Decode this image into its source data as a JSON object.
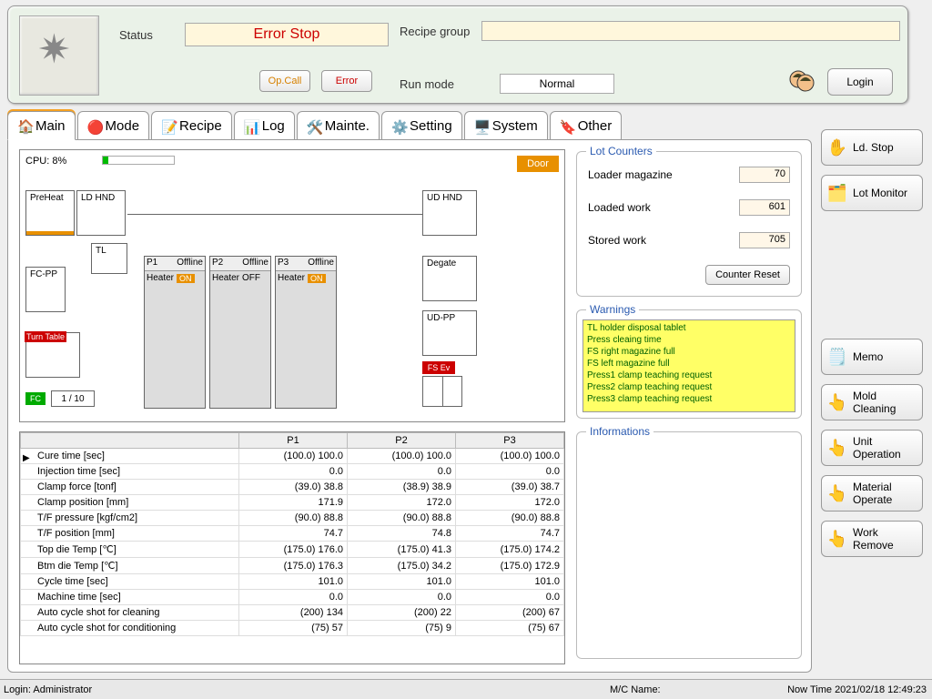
{
  "header": {
    "status_label": "Status",
    "status_value": "Error Stop",
    "opcall": "Op.Call",
    "error": "Error",
    "recipe_group_label": "Recipe group",
    "recipe_group_value": "",
    "run_mode_label": "Run mode",
    "run_mode_value": "Normal",
    "login": "Login"
  },
  "tabs": {
    "main": "Main",
    "mode": "Mode",
    "recipe": "Recipe",
    "log": "Log",
    "mainte": "Mainte.",
    "setting": "Setting",
    "system": "System",
    "other": "Other"
  },
  "diagram": {
    "cpu": "CPU:  8%",
    "door": "Door",
    "preheat": "PreHeat",
    "ldhnd": "LD HND",
    "tl": "TL",
    "fcpp": "FC-PP",
    "turntable": "Turn Table",
    "fc": "FC",
    "fc_count": "1 / 10",
    "udhnd": "UD HND",
    "degate": "Degate",
    "udpp": "UD-PP",
    "fsev": "FS Ev",
    "press": [
      {
        "name": "P1",
        "status": "Offline",
        "heater_label": "Heater",
        "heater_state": "ON",
        "heater_on": true
      },
      {
        "name": "P2",
        "status": "Offline",
        "heater_label": "Heater",
        "heater_state": "OFF",
        "heater_on": false
      },
      {
        "name": "P3",
        "status": "Offline",
        "heater_label": "Heater",
        "heater_state": "ON",
        "heater_on": true
      }
    ]
  },
  "grid": {
    "headers": [
      "",
      "P1",
      "P2",
      "P3"
    ],
    "rows": [
      {
        "label": "Cure time [sec]",
        "p1": "(100.0) 100.0",
        "p2": "(100.0) 100.0",
        "p3": "(100.0) 100.0"
      },
      {
        "label": "Injection time [sec]",
        "p1": "0.0",
        "p2": "0.0",
        "p3": "0.0"
      },
      {
        "label": "Clamp force [tonf]",
        "p1": "(39.0) 38.8",
        "p2": "(38.9) 38.9",
        "p3": "(39.0) 38.7"
      },
      {
        "label": "Clamp position [mm]",
        "p1": "171.9",
        "p2": "172.0",
        "p3": "172.0"
      },
      {
        "label": "T/F pressure [kgf/cm2]",
        "p1": "(90.0) 88.8",
        "p2": "(90.0) 88.8",
        "p3": "(90.0) 88.8"
      },
      {
        "label": "T/F position [mm]",
        "p1": "74.7",
        "p2": "74.8",
        "p3": "74.7"
      },
      {
        "label": "Top die Temp [℃]",
        "p1": "(175.0) 176.0",
        "p2": "(175.0) 41.3",
        "p3": "(175.0) 174.2"
      },
      {
        "label": "Btm die Temp [℃]",
        "p1": "(175.0) 176.3",
        "p2": "(175.0) 34.2",
        "p3": "(175.0) 172.9"
      },
      {
        "label": "Cycle time [sec]",
        "p1": "101.0",
        "p2": "101.0",
        "p3": "101.0"
      },
      {
        "label": "Machine time [sec]",
        "p1": "0.0",
        "p2": "0.0",
        "p3": "0.0"
      },
      {
        "label": "Auto cycle shot for cleaning",
        "p1": "(200) 134",
        "p2": "(200) 22",
        "p3": "(200) 67"
      },
      {
        "label": "Auto cycle shot for conditioning",
        "p1": "(75) 57",
        "p2": "(75) 9",
        "p3": "(75) 67"
      }
    ]
  },
  "lot": {
    "title": "Lot Counters",
    "loader_mag_label": "Loader magazine",
    "loader_mag_value": "70",
    "loaded_work_label": "Loaded work",
    "loaded_work_value": "601",
    "stored_work_label": "Stored work",
    "stored_work_value": "705",
    "counter_reset": "Counter Reset"
  },
  "warnings": {
    "title": "Warnings",
    "items": [
      "TL holder disposal tablet",
      "Press cleaing time",
      "FS right magazine full",
      "FS left magazine full",
      "Press1 clamp teaching request",
      "Press2 clamp teaching request",
      "Press3 clamp teaching request"
    ]
  },
  "informations": {
    "title": "Informations"
  },
  "sidebuttons": {
    "ldstop": "Ld. Stop",
    "lotmonitor": "Lot Monitor",
    "memo": "Memo",
    "moldcleaning": "Mold Cleaning",
    "unitoperation": "Unit Operation",
    "materialoperate": "Material Operate",
    "workremove": "Work Remove"
  },
  "statusbar": {
    "login": "Login: Administrator",
    "mc": "M/C Name:",
    "time": "Now Time  2021/02/18 12:49:23"
  }
}
